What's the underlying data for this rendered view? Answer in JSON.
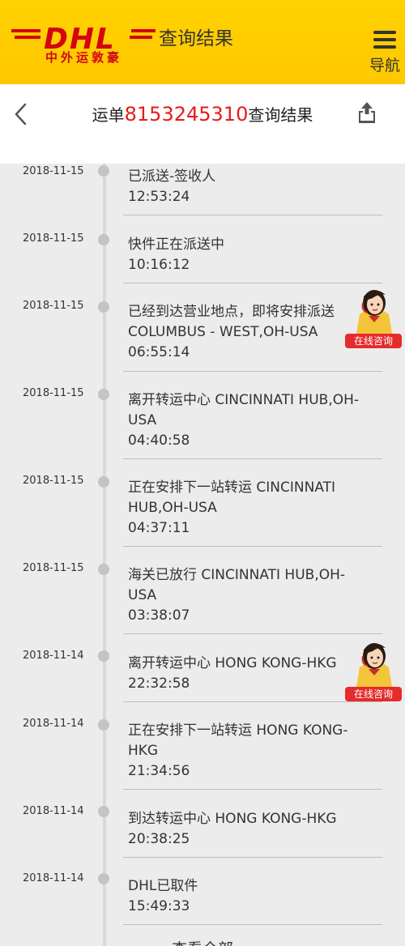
{
  "header": {
    "brand": "DHL",
    "brand_cn": "中外运敦豪",
    "title": "查询结果",
    "nav_label": "导航"
  },
  "subheader": {
    "prefix": "运单",
    "waybill": "8153245310",
    "suffix": "查询结果"
  },
  "consult_label": "在线咨询",
  "events": [
    {
      "date": "2018-11-15",
      "lines": [
        "已派送-签收人",
        "12:53:24"
      ]
    },
    {
      "date": "2018-11-15",
      "lines": [
        "快件正在派送中",
        "10:16:12"
      ]
    },
    {
      "date": "2018-11-15",
      "lines": [
        "已经到达营业地点，即将安排派送",
        "COLUMBUS - WEST,OH-USA",
        "06:55:14"
      ]
    },
    {
      "date": "2018-11-15",
      "lines": [
        "离开转运中心 CINCINNATI HUB,OH-",
        "USA",
        "04:40:58"
      ]
    },
    {
      "date": "2018-11-15",
      "lines": [
        "正在安排下一站转运 CINCINNATI",
        "HUB,OH-USA",
        "04:37:11"
      ]
    },
    {
      "date": "2018-11-15",
      "lines": [
        "海关已放行 CINCINNATI HUB,OH-",
        "USA",
        "03:38:07"
      ]
    },
    {
      "date": "2018-11-14",
      "lines": [
        "离开转运中心 HONG KONG-HKG",
        "22:32:58"
      ]
    },
    {
      "date": "2018-11-14",
      "lines": [
        "正在安排下一站转运 HONG KONG-",
        "HKG",
        "21:34:56"
      ]
    },
    {
      "date": "2018-11-14",
      "lines": [
        "到达转运中心 HONG KONG-HKG",
        "20:38:25"
      ]
    },
    {
      "date": "2018-11-14",
      "lines": [
        "DHL已取件",
        "15:49:33"
      ]
    }
  ],
  "more_label": "查看全部"
}
